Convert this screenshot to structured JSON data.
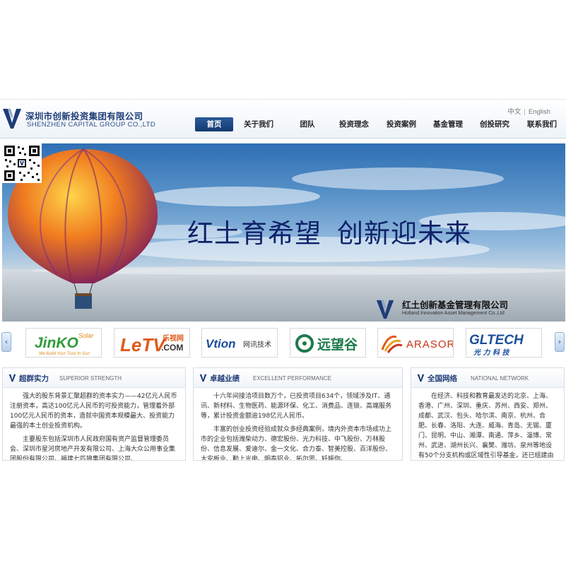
{
  "brand": {
    "name_cn": "深圳市创新投资集团有限公司",
    "name_en": "SHENZHEN CAPITAL GROUP CO.,LTD",
    "accent": "#1f3d78"
  },
  "language": {
    "chinese": "中文",
    "separator": "|",
    "english": "English"
  },
  "nav": {
    "items": [
      {
        "label": "首页"
      },
      {
        "label": "关于我们"
      },
      {
        "label": "团队"
      },
      {
        "label": "投资理念"
      },
      {
        "label": "投资案例"
      },
      {
        "label": "基金管理"
      },
      {
        "label": "创投研究"
      },
      {
        "label": "联系我们"
      }
    ],
    "active_color": "#1d4680"
  },
  "banner": {
    "slogan_left": "红土育希望",
    "slogan_right": "创新迎未来",
    "fund_name_cn": "红土创新基金管理有限公司",
    "fund_name_en": "Hotland Innovation Asset Management Co.,Ltd",
    "qr_icon": "qr-code-icon"
  },
  "partners": {
    "prev_icon": "chevron-left-icon",
    "next_icon": "chevron-right-icon",
    "prev_glyph": "‹",
    "next_glyph": "›",
    "logos": [
      {
        "name": "JinKO",
        "tag": "Solar",
        "tagline": "We Build Your Trust In Sun"
      },
      {
        "name": "LeTV",
        "cn": "乐视网",
        "suffix": ".COM"
      },
      {
        "name": "Vtion",
        "cn": "网讯技术"
      },
      {
        "name": "远望谷"
      },
      {
        "name": "ARASOR"
      },
      {
        "name": "GLTECH",
        "cn": "光 力 科 技"
      }
    ]
  },
  "boxes": [
    {
      "title": "超群实力",
      "subtitle": "SUPERIOR STRENGTH",
      "paragraphs": [
        "强大的股东背景汇聚超群的资本实力——42亿元人民币注册资本，高达100亿元人民币的可投资能力，管理着外部100亿元人民币的资本，造就中国资本规模最大、投资能力最强的本土创业投资机构。",
        "主要股东包括深圳市人民政府国有资产监督管理委员会、深圳市星河房地产开发有限公司、上海大众公用事业集团股份有限公司、福建七匹狼集团有限公司、"
      ]
    },
    {
      "title": "卓越业绩",
      "subtitle": "EXCELLENT PERFORMANCE",
      "paragraphs": [
        "十六年间接洽项目数万个，已投资项目634个，领域涉及IT、通讯、新材料、生物医药、能源环保、化工、消费品、连锁、高端服务等，累计投资金额逾198亿元人民币。",
        "丰富的创业投资经验成就众多经典案例，境内外资本市场成功上市的企业包括潍柴动力、德宏股份、光力科技、中飞股份、万林股份、信息发展、爱迪尔、金一文化、合力泰、智美控股、百洋股份、太安板业、勤上光电、明泰铝业、拓尔思、妊娠你、"
      ]
    },
    {
      "title": "全国网络",
      "subtitle": "NATIONAL NETWORK",
      "paragraphs": [
        "在经济、科技和教育最发达的北京、上海、香港、广州、深圳、重庆、苏州、西安、郑州、成都、武汉、包头、哈尔滨、南京、杭州、合肥、长春、洛阳、大连、威海、青岛、无锡、厦门、昆明、中山、湘潭、南通、萍乡、淄博、常州、武进、湖州长兴、襄樊、潍坊、泉州等地设有50个分支机构或区域性引导基金，还已组建由"
      ]
    }
  ]
}
